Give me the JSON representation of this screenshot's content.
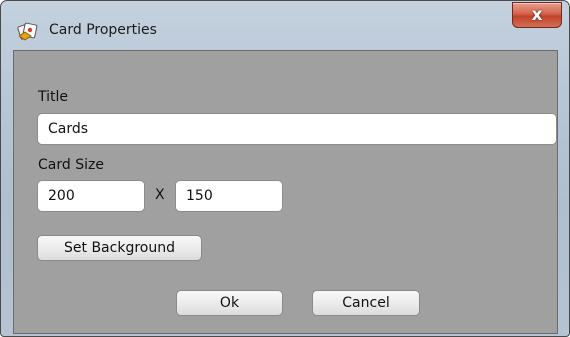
{
  "window": {
    "title": "Card Properties",
    "close_label": "x"
  },
  "icons": {
    "app": "card-properties-app-icon",
    "close": "close-icon"
  },
  "form": {
    "title_label": "Title",
    "title_value": "Cards",
    "card_size_label": "Card Size",
    "width_value": "200",
    "size_separator": "X",
    "height_value": "150"
  },
  "buttons": {
    "set_background": "Set Background",
    "ok": "Ok",
    "cancel": "Cancel"
  },
  "colors": {
    "client_background": "#a0a0a0",
    "close_button": "#c94a32",
    "title_bar": "#b7c6d6"
  }
}
